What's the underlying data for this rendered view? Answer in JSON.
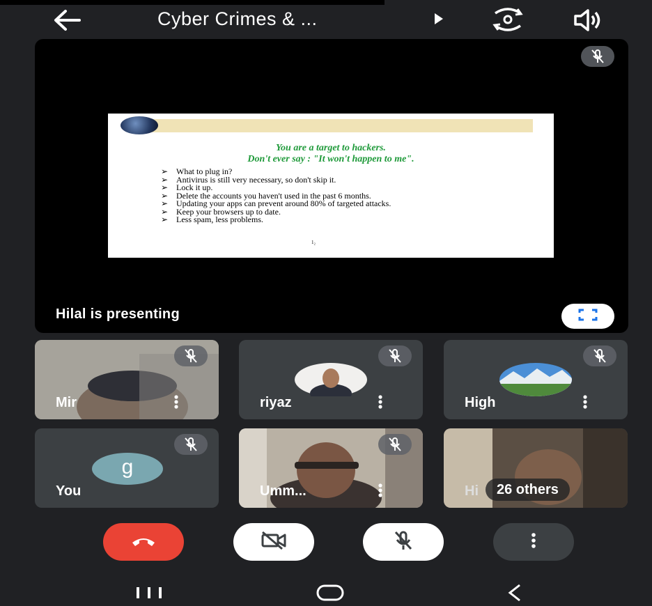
{
  "header": {
    "title": "Cyber Crimes & ...",
    "icons": [
      "back-arrow-icon",
      "cast-play-icon",
      "switch-camera-icon",
      "speaker-icon"
    ]
  },
  "presentation": {
    "caption": "Hilal is presenting",
    "slide": {
      "heading_line1": "You are a target to hackers.",
      "heading_line2": "Don't ever say : \"It won't happen to me\".",
      "bullets": [
        "What to plug in?",
        "Antivirus is still very necessary, so don't skip it.",
        "Lock it up.",
        "Delete the accounts you haven't used in the past 6 months.",
        "Updating your apps can prevent around 80% of targeted attacks.",
        "Keep your browsers up to date.",
        "Less spam, less problems."
      ],
      "page_number": "1₂"
    }
  },
  "participants": [
    {
      "name": "Mir"
    },
    {
      "name": "riyaz"
    },
    {
      "name": "High"
    },
    {
      "name": "You",
      "avatar_letter": "g"
    },
    {
      "name": "Umm..."
    },
    {
      "name": "Hi",
      "others": "26 others"
    }
  ],
  "controls": {
    "colors": {
      "end_call": "#ea4335",
      "toggle_bg": "#ffffff",
      "more_bg": "#3c4043"
    }
  },
  "colors": {
    "background": "#202124",
    "tile": "#3c4043",
    "slide_heading": "#1f9a3a"
  }
}
